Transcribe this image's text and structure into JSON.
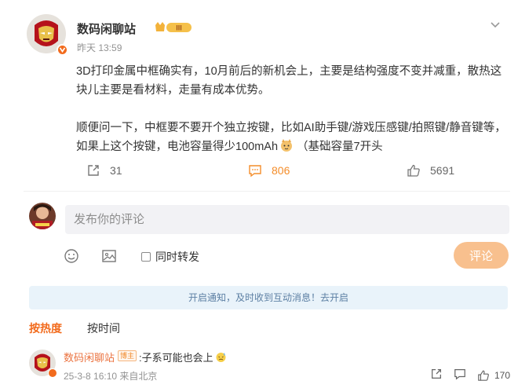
{
  "post": {
    "author": "数码闲聊站",
    "level_badge": "III",
    "time": "昨天 13:59",
    "paragraphs": [
      "3D打印金属中框确实有，10月前后的新机会上，主要是结构强度不变并减重，散热这块儿主要是看材料，走量有成本优势。",
      "顺便问一下，中框要不要开个独立按键，比如AI助手键/游戏压感键/拍照键/静音键等，如果上这个按键，电池容量得少100mAh"
    ],
    "paragraph_tail": "（基础容量7开头",
    "repost_count": "31",
    "comment_count": "806",
    "like_count": "5691"
  },
  "composer": {
    "placeholder": "发布你的评论",
    "repost_label": "同时转发",
    "submit_label": "评论"
  },
  "notice": "开启通知，及时收到互动消息！去开启",
  "sort_tabs": [
    {
      "label": "按热度",
      "active": true
    },
    {
      "label": "按时间",
      "active": false
    }
  ],
  "comments": [
    {
      "author": "数码闲聊站",
      "badge": "博主",
      "text": ":子系可能也会上",
      "meta": "25-3-8 16:10 来自北京",
      "likes": "170"
    }
  ],
  "colors": {
    "accent": "#f26b1d",
    "comment_active": "#f48d2a",
    "submit_disabled": "#f8c08e",
    "notice_bg": "#e9f3fa"
  },
  "icons": {
    "expand": "chevron-down-icon",
    "repost": "share-icon",
    "comment": "comment-icon",
    "like": "thumbs-up-icon",
    "emoji": "smiley-icon",
    "image": "image-icon"
  }
}
